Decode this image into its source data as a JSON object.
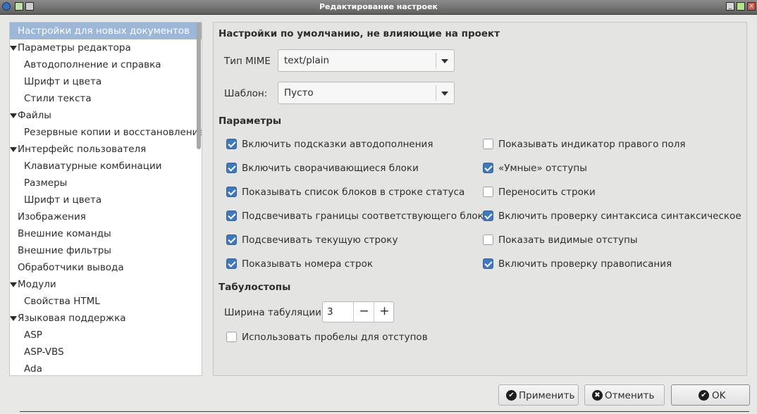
{
  "window": {
    "title": "Редактирование настроек",
    "close_glyph": "×",
    "min_glyph": "_"
  },
  "sidebar": {
    "items": [
      {
        "label": "Настройки для новых документов",
        "level": 0,
        "selected": true,
        "expandable": false
      },
      {
        "label": "Параметры редактора",
        "level": 0,
        "expandable": true
      },
      {
        "label": "Автодополнение и справка",
        "level": 1
      },
      {
        "label": "Шрифт и цвета",
        "level": 1
      },
      {
        "label": "Стили текста",
        "level": 1
      },
      {
        "label": "Файлы",
        "level": 0,
        "expandable": true
      },
      {
        "label": "Резервные копии и восстановление",
        "level": 1
      },
      {
        "label": "Интерфейс пользователя",
        "level": 0,
        "expandable": true
      },
      {
        "label": "Клавиатурные комбинации",
        "level": 1
      },
      {
        "label": "Размеры",
        "level": 1
      },
      {
        "label": "Шрифт и цвета",
        "level": 1
      },
      {
        "label": "Изображения",
        "level": 0,
        "expandable": false
      },
      {
        "label": "Внешние команды",
        "level": 0,
        "expandable": false
      },
      {
        "label": "Внешние фильтры",
        "level": 0,
        "expandable": false
      },
      {
        "label": "Обработчики вывода",
        "level": 0,
        "expandable": false
      },
      {
        "label": "Модули",
        "level": 0,
        "expandable": true
      },
      {
        "label": "Свойства HTML",
        "level": 1
      },
      {
        "label": "Языковая поддержка",
        "level": 0,
        "expandable": true
      },
      {
        "label": "ASP",
        "level": 1
      },
      {
        "label": "ASP-VBS",
        "level": 1
      },
      {
        "label": "Ada",
        "level": 1
      }
    ]
  },
  "main": {
    "section_defaults": "Настройки по умолчанию, не влияющие на проект",
    "mime_label": "Тип MIME",
    "mime_value": "text/plain",
    "template_label": "Шаблон:",
    "template_value": "Пусто",
    "section_params": "Параметры",
    "options_left": [
      {
        "label": "Включить подсказки автодополнения",
        "checked": true
      },
      {
        "label": "Включить сворачивающиеся блоки",
        "checked": true
      },
      {
        "label": "Показывать список блоков в строке статуса",
        "checked": true
      },
      {
        "label": "Подсвечивать границы соответствующего блока",
        "checked": true
      },
      {
        "label": "Подсвечивать текущую строку",
        "checked": true
      },
      {
        "label": "Показывать номера строк",
        "checked": true
      }
    ],
    "options_right": [
      {
        "label": "Показывать индикатор правого поля",
        "checked": false
      },
      {
        "label": "«Умные» отступы",
        "checked": true
      },
      {
        "label": "Переносить строки",
        "checked": false
      },
      {
        "label": "Включить проверку синтаксиса синтаксическое",
        "checked": true
      },
      {
        "label": "Показать видимые отступы",
        "checked": false
      },
      {
        "label": "Включить проверку правописания",
        "checked": true
      }
    ],
    "section_tabs": "Табулостопы",
    "tab_width_label": "Ширина табуляции",
    "tab_width_value": "3",
    "minus": "−",
    "plus": "+",
    "use_spaces_label": "Использовать пробелы для отступов",
    "use_spaces_checked": false
  },
  "buttons": {
    "apply": "Применить",
    "apply_glyph": "✔",
    "cancel": "Отменить",
    "cancel_glyph": "✖",
    "ok": "OK",
    "ok_glyph": "✔"
  }
}
